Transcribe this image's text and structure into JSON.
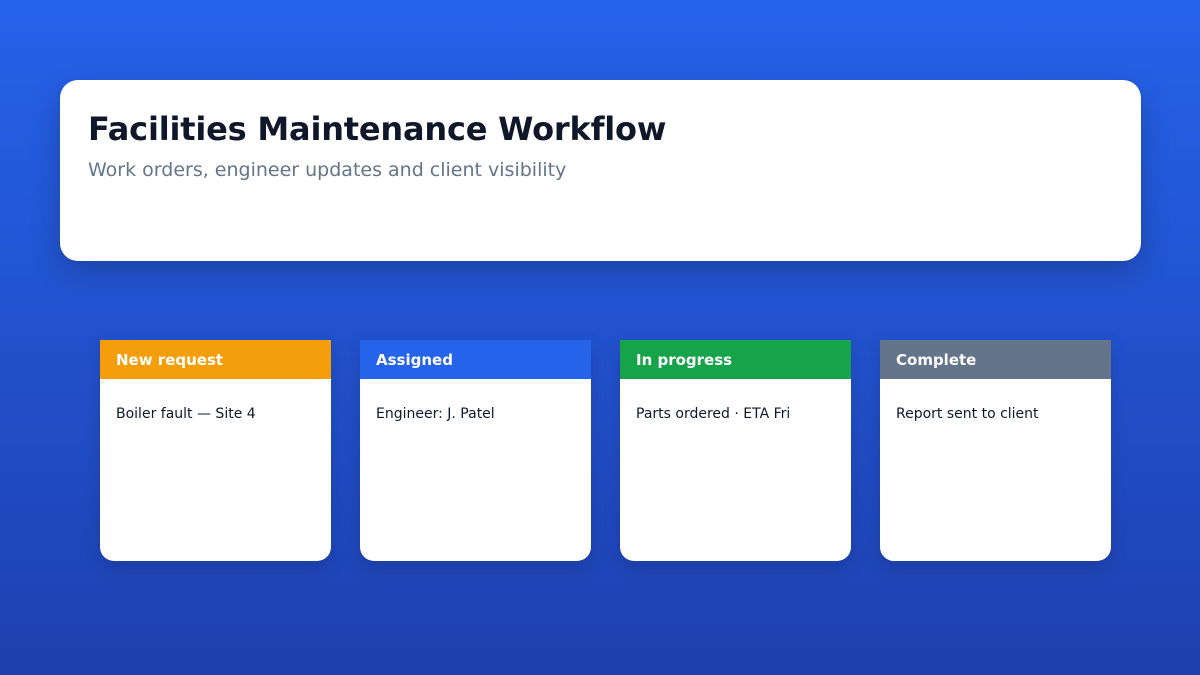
{
  "header": {
    "title": "Facilities Maintenance Workflow",
    "subtitle": "Work orders, engineer updates and client visibility"
  },
  "stages": [
    {
      "label": "New request",
      "detail": "Boiler fault — Site 4",
      "color": "#f59e0b"
    },
    {
      "label": "Assigned",
      "detail": "Engineer: J. Patel",
      "color": "#2563eb"
    },
    {
      "label": "In progress",
      "detail": "Parts ordered · ETA Fri",
      "color": "#16a34a"
    },
    {
      "label": "Complete",
      "detail": "Report sent to client",
      "color": "#64748b"
    }
  ],
  "colors": {
    "background_top": "#2563eb",
    "background_bottom": "#1e40af",
    "title": "#0f172a",
    "subtitle": "#64748b"
  }
}
